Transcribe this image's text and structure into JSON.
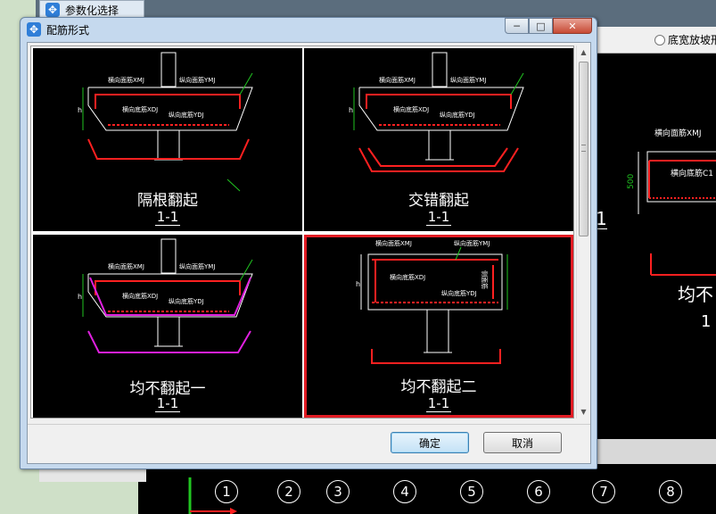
{
  "background": {
    "window_title": "参数化选择",
    "radio_label": "底宽放坡形",
    "right_preview": {
      "label_top": "横向面筋XMJ",
      "label_mid": "横向底筋C1",
      "dimension": "500",
      "name": "均不",
      "section": "1"
    },
    "left_fragment": "1",
    "axis_numbers": [
      "1",
      "2",
      "3",
      "4",
      "5",
      "6",
      "7",
      "8"
    ]
  },
  "dialog": {
    "title": "配筋形式",
    "window_buttons": {
      "minimize": "─",
      "maximize": "□",
      "close": "✕"
    },
    "options": [
      {
        "name": "隔根翻起",
        "section": "1-1",
        "selected": false
      },
      {
        "name": "交错翻起",
        "section": "1-1",
        "selected": false
      },
      {
        "name": "均不翻起一",
        "section": "1-1",
        "selected": false
      },
      {
        "name": "均不翻起二",
        "section": "1-1",
        "selected": true
      }
    ],
    "drawing_labels": {
      "top_face": "横向面筋XMJ",
      "long_face": "纵向面筋YMJ",
      "bottom": "横向底筋XDJ",
      "long_bottom": "纵向底筋YDJ",
      "side_rebar": "侧面筋",
      "height": "h"
    },
    "ok_label": "确定",
    "cancel_label": "取消"
  },
  "colors": {
    "highlight": "#e21c24",
    "rebar_red": "#ff2020",
    "rebar_magenta": "#e020e0",
    "annotation_green": "#21c521"
  }
}
